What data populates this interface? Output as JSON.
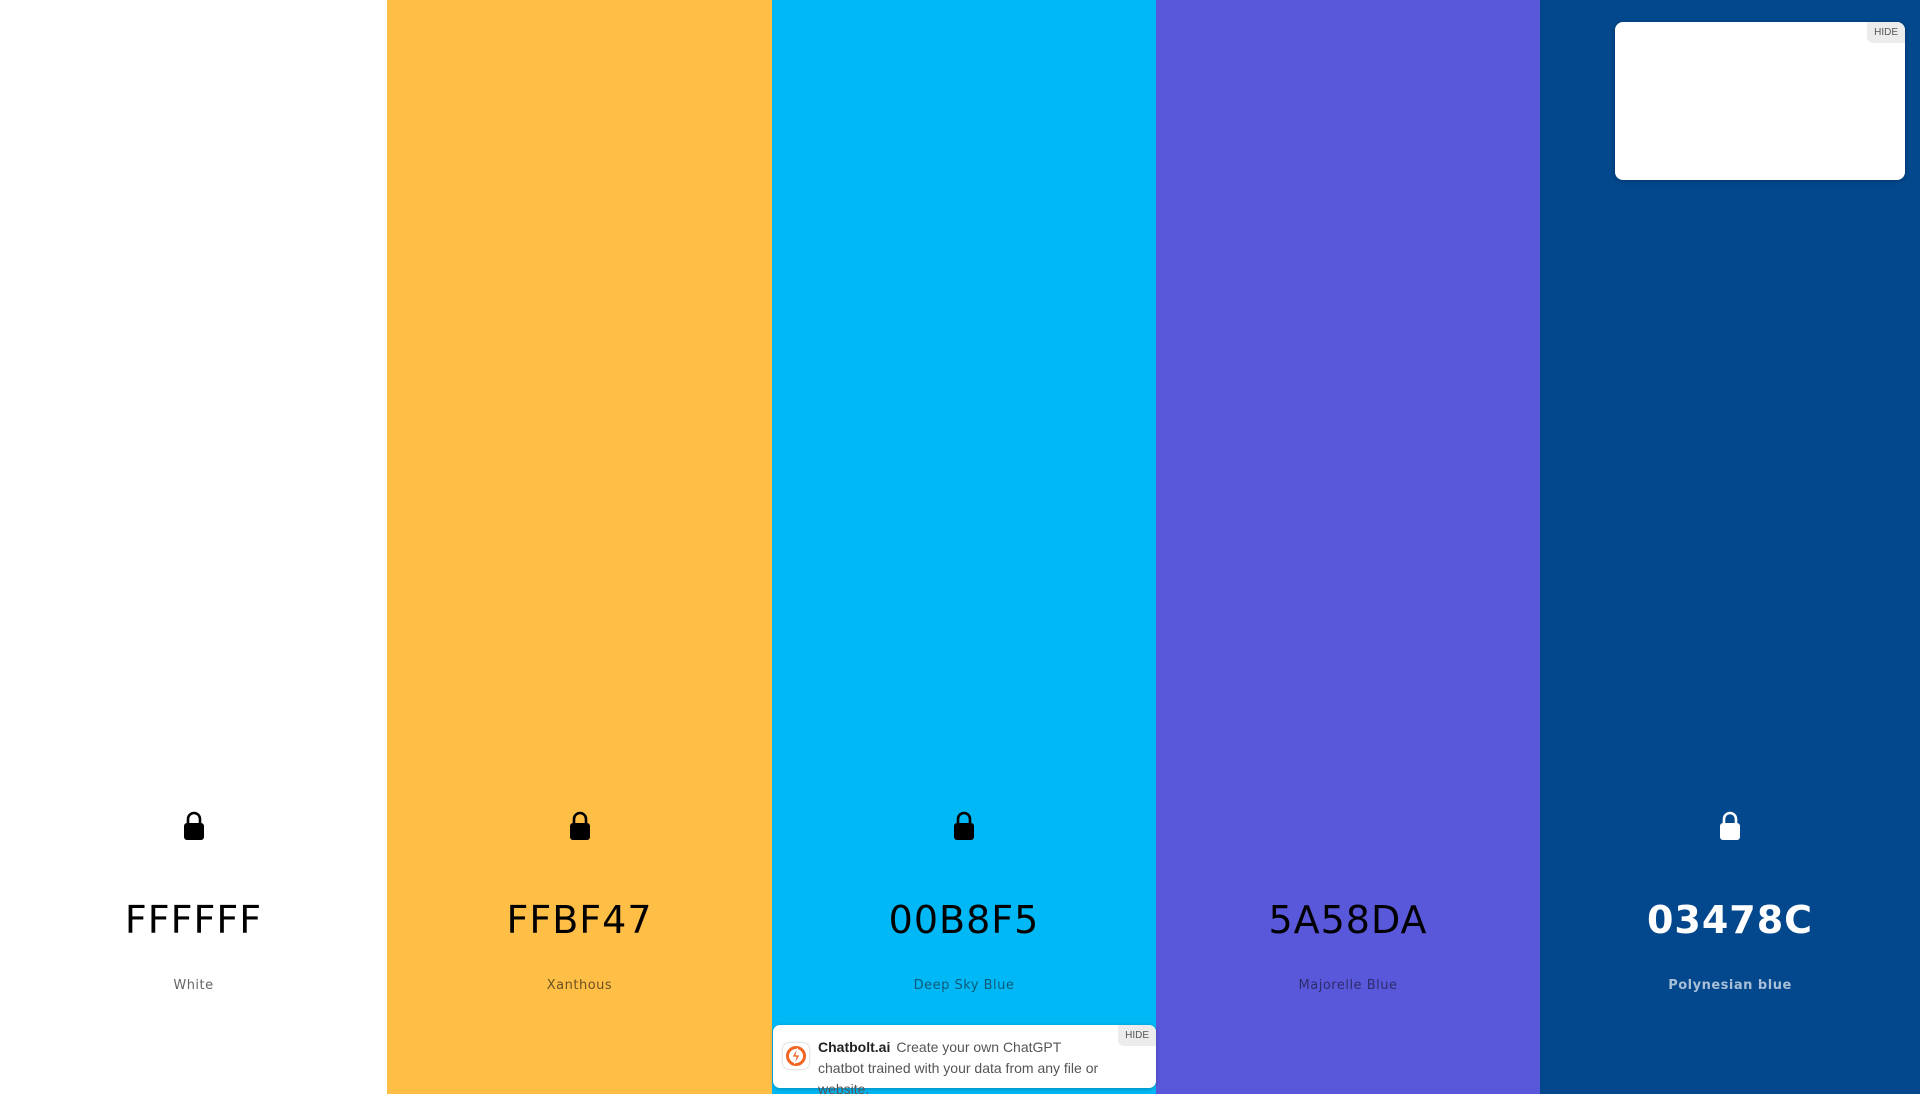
{
  "swatches": [
    {
      "hex": "FFFFFF",
      "name": "White",
      "bg": "#FFFFFF",
      "text_color": "#000000",
      "name_color": "#666666",
      "lock_color": "#000000",
      "lock_visible": true
    },
    {
      "hex": "FFBF47",
      "name": "Xanthous",
      "bg": "#FFBF47",
      "text_color": "#000000",
      "name_color": "#6b5020",
      "lock_color": "#000000",
      "lock_visible": true
    },
    {
      "hex": "00B8F5",
      "name": "Deep Sky Blue",
      "bg": "#00B8F5",
      "text_color": "#000000",
      "name_color": "#0d5a78",
      "lock_color": "#000000",
      "lock_visible": true
    },
    {
      "hex": "5A58DA",
      "name": "Majorelle Blue",
      "bg": "#5A58DA",
      "text_color": "#000000",
      "name_color": "#2d2c6e",
      "lock_color": "#000000",
      "lock_visible": false
    },
    {
      "hex": "03478C",
      "name": "Polynesian blue",
      "bg": "#03478C",
      "text_color": "#FFFFFF",
      "name_color": "#a8bfd8",
      "lock_color": "#FFFFFF",
      "lock_visible": true
    }
  ],
  "ad_top": {
    "hide_label": "HIDE"
  },
  "chatbolt_ad": {
    "brand": "Chatbolt.ai",
    "message": "Create your own ChatGPT chatbot trained with your data from any file or website.",
    "hide_label": "HIDE",
    "logo_icon": "chatbolt-logo-icon",
    "brand_color": "#F26522"
  }
}
